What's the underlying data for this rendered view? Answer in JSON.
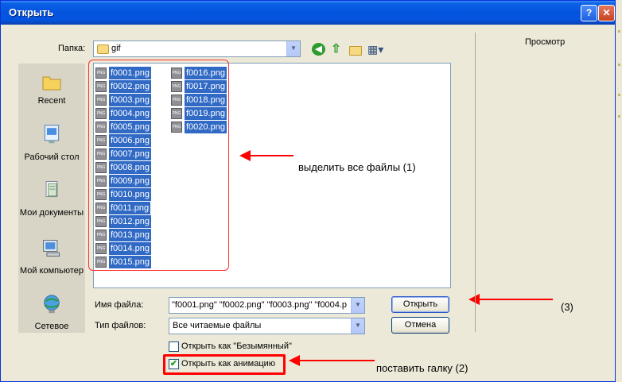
{
  "window": {
    "title": "Открыть",
    "help_glyph": "?",
    "close_glyph": "✕"
  },
  "toolbar": {
    "folder_label": "Папка:",
    "folder_value": "gif",
    "icons": [
      "back-icon",
      "up-icon",
      "new-folder-icon",
      "view-menu-icon"
    ]
  },
  "places": [
    {
      "label": "Recent",
      "icon": "recent-folder-icon"
    },
    {
      "label": "Рабочий стол",
      "icon": "desktop-icon"
    },
    {
      "label": "Мои документы",
      "icon": "my-documents-icon"
    },
    {
      "label": "Мой компьютер",
      "icon": "my-computer-icon"
    },
    {
      "label": "Сетевое",
      "icon": "network-icon"
    }
  ],
  "files": {
    "col1": [
      "f0001.png",
      "f0002.png",
      "f0003.png",
      "f0004.png",
      "f0005.png",
      "f0006.png",
      "f0007.png",
      "f0008.png",
      "f0009.png",
      "f0010.png",
      "f0011.png",
      "f0012.png",
      "f0013.png",
      "f0014.png",
      "f0015.png"
    ],
    "col2": [
      "f0016.png",
      "f0017.png",
      "f0018.png",
      "f0019.png",
      "f0020.png"
    ],
    "icon_text": "PNG"
  },
  "form": {
    "filename_label": "Имя файла:",
    "filename_value": "\"f0001.png\" \"f0002.png\" \"f0003.png\" \"f0004.p",
    "filetype_label": "Тип файлов:",
    "filetype_value": "Все читаемые файлы",
    "open_button": "Открыть",
    "cancel_button": "Отмена",
    "open_untitled_label": "Открыть как \"Безымянный\"",
    "open_untitled_checked": false,
    "open_animation_label": "Открыть как анимацию",
    "open_animation_checked": true
  },
  "preview": {
    "label": "Просмотр"
  },
  "annotations": {
    "select_all": "выделить все файлы (1)",
    "press_open": "(3)",
    "set_check": "поставить галку (2)"
  },
  "colors": {
    "selection": "#316ac5",
    "annotation_red": "#ff0000",
    "titlebar": "#0554e0",
    "dialog_bg": "#ece9d8"
  }
}
